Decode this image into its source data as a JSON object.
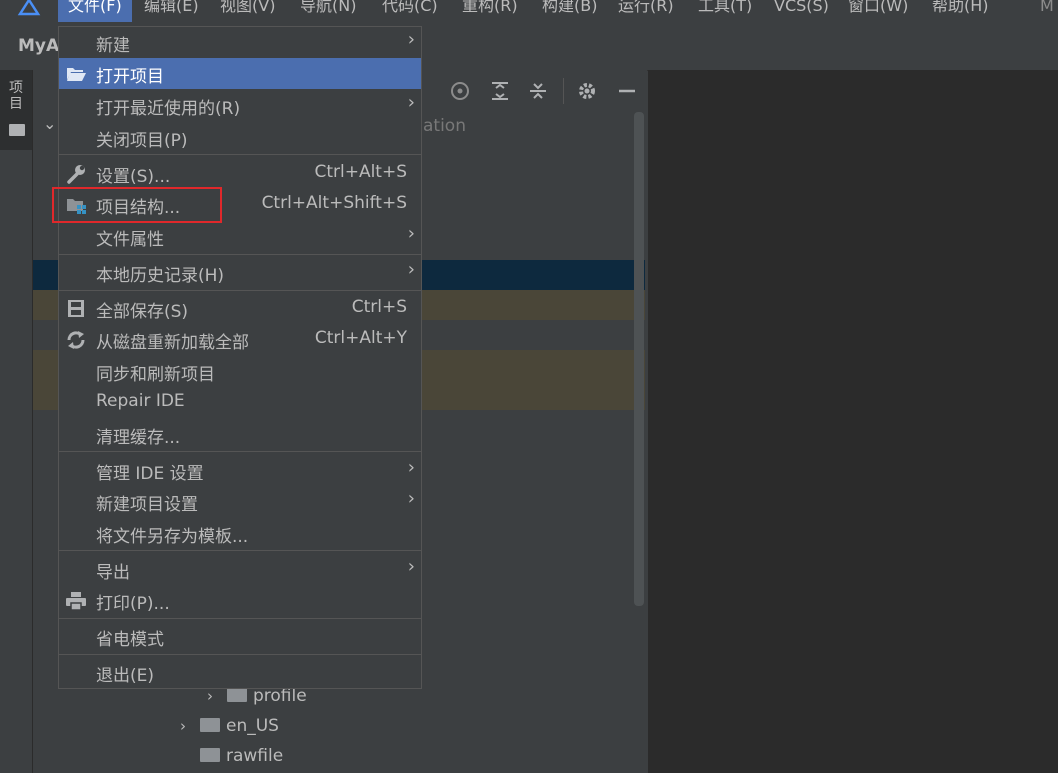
{
  "menubar": {
    "items": [
      "文件(F)",
      "编辑(E)",
      "视图(V)",
      "导航(N)",
      "代码(C)",
      "重构(R)",
      "构建(B)",
      "运行(R)",
      "工具(T)",
      "VCS(S)",
      "窗口(W)",
      "帮助(H)"
    ],
    "trailing": "M"
  },
  "title": {
    "project": "MyA"
  },
  "left_tab": {
    "label": "项目"
  },
  "panel": {
    "truncated_text": "ation"
  },
  "tree": [
    {
      "name": "profile"
    },
    {
      "name": "en_US"
    },
    {
      "name": "rawfile"
    }
  ],
  "file_menu": {
    "items": [
      {
        "label": "新建",
        "submenu": true
      },
      {
        "label": "打开项目",
        "icon": "open-folder-icon",
        "selected": true
      },
      {
        "label": "打开最近使用的(R)",
        "submenu": true
      },
      {
        "label": "关闭项目(P)"
      },
      {
        "label": "设置(S)...",
        "icon": "wrench-icon",
        "shortcut": "Ctrl+Alt+S"
      },
      {
        "label": "项目结构...",
        "icon": "project-structure-icon",
        "shortcut": "Ctrl+Alt+Shift+S"
      },
      {
        "label": "文件属性",
        "submenu": true
      },
      {
        "label": "本地历史记录(H)",
        "submenu": true
      },
      {
        "label": "全部保存(S)",
        "icon": "save-icon",
        "shortcut": "Ctrl+S"
      },
      {
        "label": "从磁盘重新加载全部",
        "icon": "reload-icon",
        "shortcut": "Ctrl+Alt+Y"
      },
      {
        "label": "同步和刷新项目"
      },
      {
        "label": "Repair IDE"
      },
      {
        "label": "清理缓存..."
      },
      {
        "label": "管理 IDE 设置",
        "submenu": true
      },
      {
        "label": "新建项目设置",
        "submenu": true
      },
      {
        "label": "将文件另存为模板..."
      },
      {
        "label": "导出",
        "submenu": true
      },
      {
        "label": "打印(P)...",
        "icon": "print-icon"
      },
      {
        "label": "省电模式"
      },
      {
        "label": "退出(E)"
      }
    ]
  },
  "colors": {
    "selection": "#4b6eaf",
    "highlight_box": "#e0282b"
  }
}
